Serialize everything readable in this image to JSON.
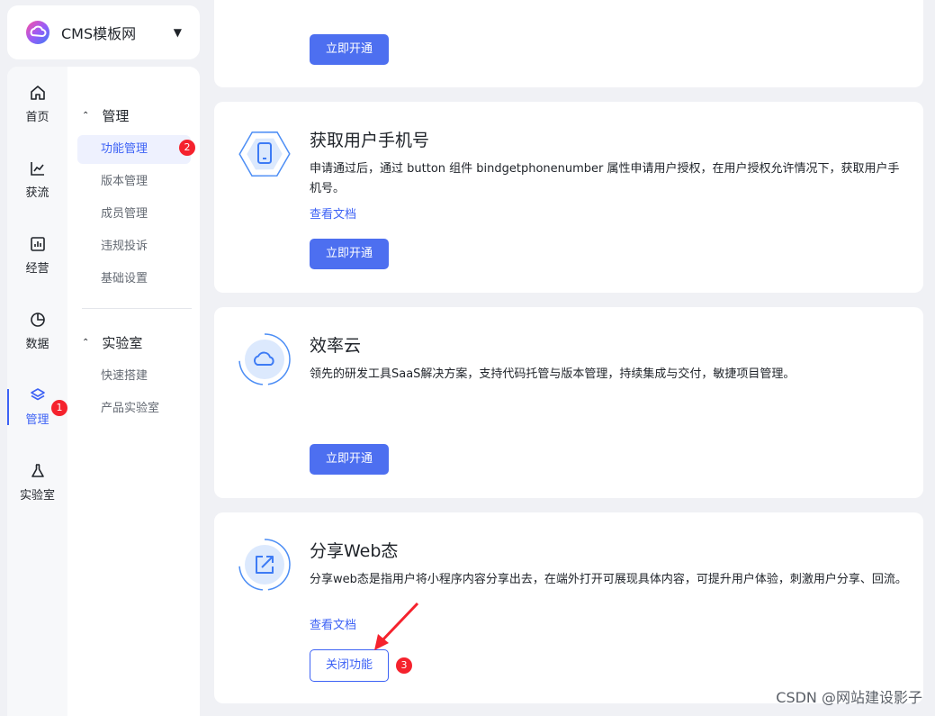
{
  "app": {
    "name": "CMS模板网"
  },
  "rail": [
    {
      "label": "首页",
      "icon": "home-icon"
    },
    {
      "label": "获流",
      "icon": "trend-chart-icon"
    },
    {
      "label": "经营",
      "icon": "bar-chart-icon"
    },
    {
      "label": "数据",
      "icon": "pie-chart-icon"
    },
    {
      "label": "管理",
      "icon": "layers-icon",
      "active": true,
      "badge": "1"
    },
    {
      "label": "实验室",
      "icon": "flask-icon"
    }
  ],
  "subnav": {
    "groups": [
      {
        "title": "管理",
        "items": [
          "功能管理",
          "版本管理",
          "成员管理",
          "违规投诉",
          "基础设置"
        ],
        "active_item": "功能管理",
        "badge": "2"
      },
      {
        "title": "实验室",
        "items": [
          "快速搭建",
          "产品实验室"
        ]
      }
    ]
  },
  "cards": [
    {
      "button": "立即开通"
    },
    {
      "title": "获取用户手机号",
      "desc": "申请通过后，通过 button 组件 bindgetphonenumber 属性申请用户授权，在用户授权允许情况下，获取用户手机号。",
      "link": "查看文档",
      "button": "立即开通",
      "icon": "phone-hexagon-icon"
    },
    {
      "title": "效率云",
      "desc": "领先的研发工具SaaS解决方案，支持代码托管与版本管理，持续集成与交付，敏捷项目管理。",
      "button": "立即开通",
      "icon": "cloud-icon"
    },
    {
      "title": "分享Web态",
      "desc": "分享web态是指用户将小程序内容分享出去，在端外打开可展现具体内容，可提升用户体验，刺激用户分享、回流。",
      "link": "查看文档",
      "button": "关闭功能",
      "badge": "3",
      "icon": "share-icon"
    }
  ],
  "watermark": "CSDN @网站建设影子",
  "colors": {
    "accent": "#3d62f5",
    "badge": "#f5222d",
    "button": "#4d6ff0"
  }
}
